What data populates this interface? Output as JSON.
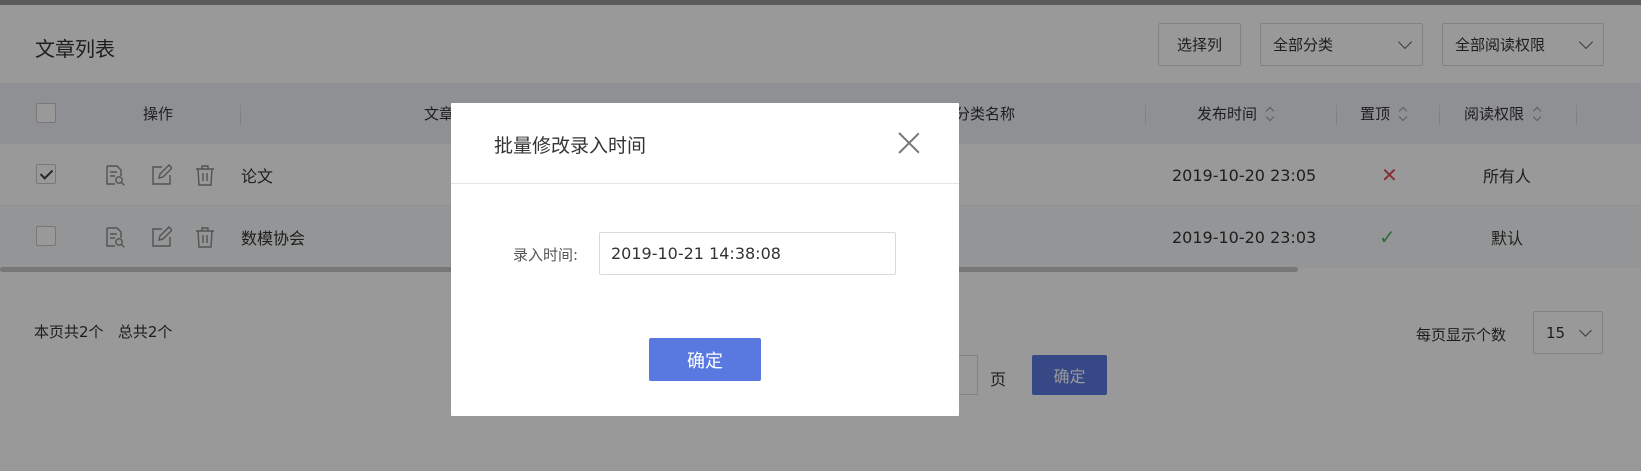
{
  "page": {
    "title": "文章列表",
    "select_columns_label": "选择列",
    "category_filter": "全部分类",
    "permission_filter": "全部阅读权限"
  },
  "table": {
    "headers": {
      "actions": "操作",
      "article": "文章",
      "category": "分类名称",
      "publish_time": "发布时间",
      "pin": "置顶",
      "permission": "阅读权限"
    },
    "rows": [
      {
        "checked": true,
        "title": "论文",
        "publish_time": "2019-10-20 23:05",
        "pinned": "✕",
        "permission": "所有人"
      },
      {
        "checked": false,
        "title": "数模协会",
        "publish_time": "2019-10-20 23:03",
        "pinned": "✓",
        "permission": "默认"
      }
    ]
  },
  "footer": {
    "page_count": "本页共2个",
    "total_count": "总共2个",
    "per_page_label": "每页显示个数",
    "per_page_value": "15",
    "page_unit": "页",
    "go_label": "确定"
  },
  "modal": {
    "title": "批量修改录入时间",
    "field_label": "录入时间:",
    "field_value": "2019-10-21 14:38:08",
    "confirm_label": "确定"
  },
  "colors": {
    "primary": "#5a79e0",
    "cross": "#e04d5a",
    "check": "#55b560",
    "header_bg": "#eef1f6"
  }
}
